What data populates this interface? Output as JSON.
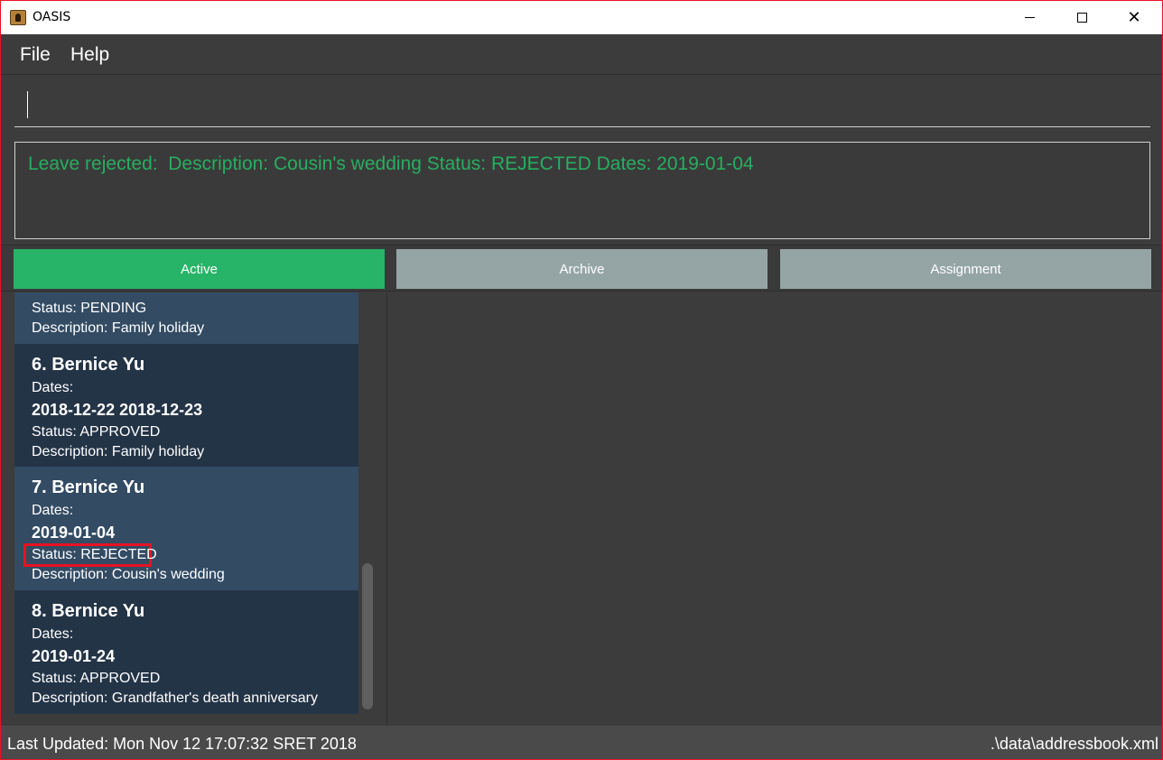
{
  "window": {
    "title": "OASIS",
    "controls": {
      "minimize": "",
      "maximize": "",
      "close": "✕"
    }
  },
  "menu": {
    "file": "File",
    "help": "Help"
  },
  "command": {
    "value": "",
    "placeholder": ""
  },
  "result": {
    "text": "Leave rejected:  Description: Cousin's wedding Status: REJECTED Dates: 2019-01-04",
    "color": "#27ae60"
  },
  "tabs": [
    {
      "label": "Active",
      "selected": true,
      "color": "#27b468"
    },
    {
      "label": "Archive",
      "selected": false,
      "color": "#95a5a6"
    },
    {
      "label": "Assignment",
      "selected": false,
      "color": "#95a5a6"
    }
  ],
  "leaves": [
    {
      "status": "Status: PENDING",
      "description": "Description: Family holiday"
    },
    {
      "heading": "6.  Bernice Yu",
      "dates_label": "Dates:",
      "dates": "2018-12-22 2018-12-23",
      "status": "Status: APPROVED",
      "description": "Description: Family holiday"
    },
    {
      "heading": "7.  Bernice Yu",
      "dates_label": "Dates:",
      "dates": "2019-01-04",
      "status": "Status: REJECTED",
      "description": "Description: Cousin's wedding",
      "highlighted": true
    },
    {
      "heading": "8.  Bernice Yu",
      "dates_label": "Dates:",
      "dates": "2019-01-24",
      "status": "Status: APPROVED",
      "description": "Description: Grandfather's death anniversary"
    }
  ],
  "statusbar": {
    "last_updated": "Last Updated: Mon Nov 12 17:07:32 SRET 2018",
    "file_path": ".\\data\\addressbook.xml"
  },
  "icons": {
    "app": "contacts-book-icon"
  },
  "colors": {
    "highlight": "#e81123",
    "card_dark": "#243447",
    "card_light": "#334b63"
  }
}
